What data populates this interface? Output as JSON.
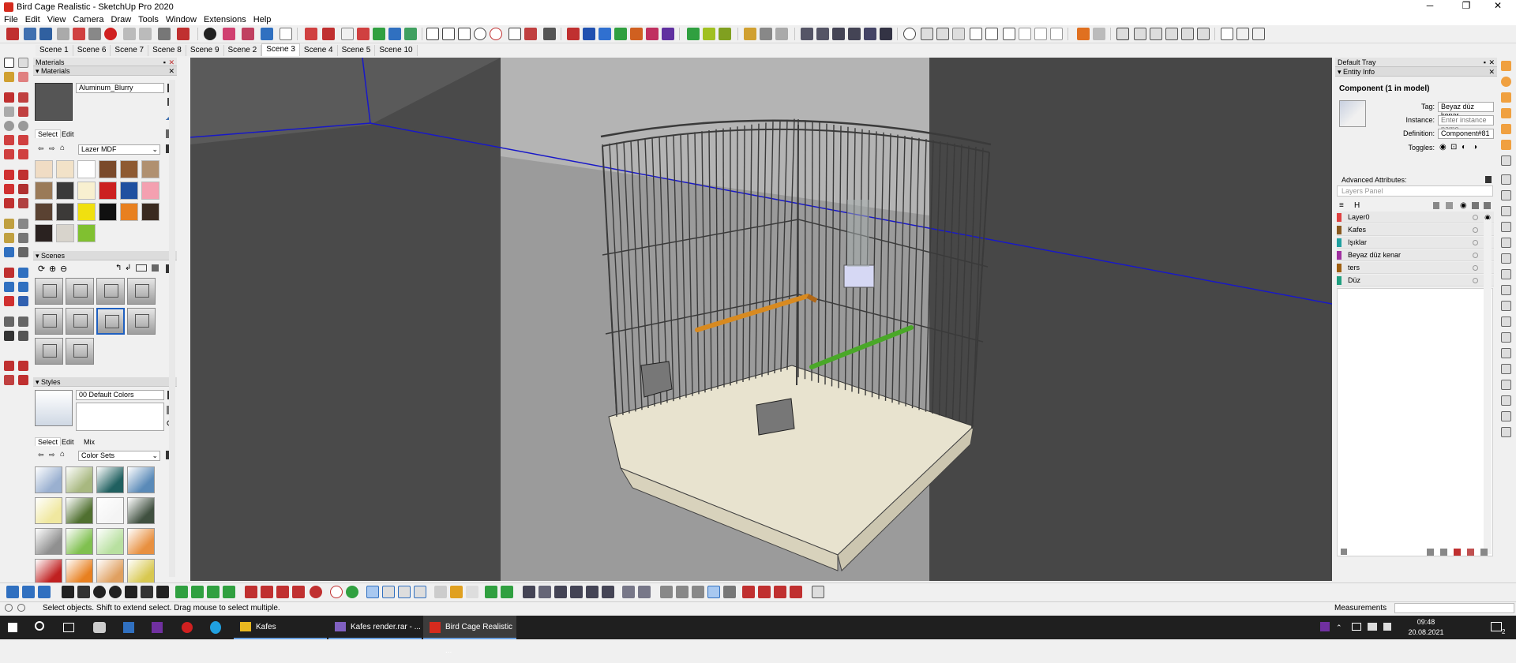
{
  "window": {
    "title": "Bird Cage Realistic - SketchUp Pro 2020",
    "minimize": "─",
    "maximize": "❐",
    "close": "✕"
  },
  "menu": [
    "File",
    "Edit",
    "View",
    "Camera",
    "Draw",
    "Tools",
    "Window",
    "Extensions",
    "Help"
  ],
  "scenes_tabs": {
    "items": [
      "Scene 1",
      "Scene 6",
      "Scene 7",
      "Scene 8",
      "Scene 9",
      "Scene 2",
      "Scene 3",
      "Scene 4",
      "Scene 5",
      "Scene 10"
    ],
    "active": "Scene 3"
  },
  "left_tray": {
    "title": "Materials",
    "materials": {
      "header": "Materials",
      "name": "Aluminum_Blurry",
      "tab_select": "Select",
      "tab_edit": "Edit",
      "collection": "Lazer MDF",
      "swatches": [
        "#f0dcc4",
        "#f2e2c8",
        "#ffffff",
        "#7a4a2a",
        "#8e5a32",
        "#b09070",
        "#9a7a58",
        "#3a3a3a",
        "#f8f0d0",
        "#cc2020",
        "#2050a0",
        "#f4a0b0",
        "#5a4232",
        "#3c3a38",
        "#f0e010",
        "#101010",
        "#e88020",
        "#3a2a20",
        "#2a2220",
        "#d8d4cc",
        "#80c030"
      ]
    },
    "scenes": {
      "header": "Scenes"
    },
    "styles": {
      "header": "Styles",
      "name": "00  Default Colors",
      "tab_select": "Select",
      "tab_edit": "Edit",
      "tab_mix": "Mix",
      "collection": "Color Sets",
      "swatches": [
        "#9ab0d0",
        "#a8b880",
        "#206060",
        "#5a8ab8",
        "#f0e8a0",
        "#507030",
        "#f4f4f4",
        "#405040",
        "#909090",
        "#80c050",
        "#b8e0a0",
        "#e89040",
        "#c02020",
        "#e88020",
        "#e0a060",
        "#d8c850"
      ]
    }
  },
  "entity_info": {
    "tray_title": "Default Tray",
    "section": "Entity Info",
    "component": "Component (1 in model)",
    "tag_label": "Tag:",
    "tag_value": "Beyaz düz kenar",
    "instance_label": "Instance:",
    "instance_placeholder": "Enter instance name",
    "definition_label": "Definition:",
    "definition_value": "Component#81",
    "toggles_label": "Toggles:",
    "advanced": "Advanced Attributes:"
  },
  "layers": {
    "panel_title": "Layers Panel",
    "header_col": "H",
    "rows": [
      {
        "name": "Layer0",
        "color": "#e04040"
      },
      {
        "name": "Kafes",
        "color": "#8a5a20"
      },
      {
        "name": "Işıklar",
        "color": "#20a0a0"
      },
      {
        "name": "Beyaz düz kenar",
        "color": "#a030a0"
      },
      {
        "name": "ters",
        "color": "#a06010"
      },
      {
        "name": "Düz",
        "color": "#20a080"
      }
    ]
  },
  "status": {
    "message": "Select objects. Shift to extend select. Drag mouse to select multiple.",
    "measurements_label": "Measurements"
  },
  "taskbar": {
    "apps": [
      {
        "label": "Kafes"
      },
      {
        "label": "Kafes render.rar - ..."
      },
      {
        "label": "Bird Cage Realistic ..."
      }
    ],
    "time": "09:48",
    "date": "20.08.2021",
    "badge": "2"
  }
}
